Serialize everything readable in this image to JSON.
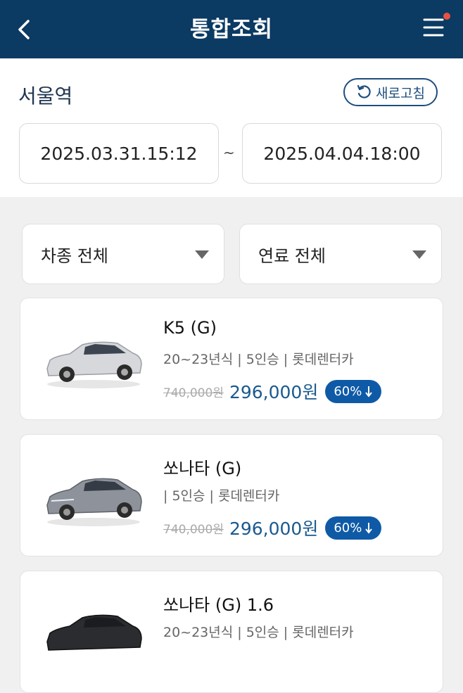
{
  "header": {
    "title": "통합조회"
  },
  "colors": {
    "header_bg": "#0b3a63",
    "accent": "#0f5aa6",
    "notification_dot": "#e8523f"
  },
  "search": {
    "station": "서울역",
    "refresh_label": "새로고침",
    "start": "2025.03.31.15:12",
    "separator": "~",
    "end": "2025.04.04.18:00"
  },
  "filters": {
    "car_type": "차종 전체",
    "fuel": "연료 전체"
  },
  "cars": [
    {
      "name": "K5 (G)",
      "spec": "20~23년식 | 5인승 | 롯데렌터카",
      "original_price": "740,000원",
      "price": "296,000원",
      "discount": "60%",
      "image_icon": "car-white-sedan-icon",
      "body_color": "#d6d8dc"
    },
    {
      "name": "쏘나타 (G)",
      "spec": "| 5인승 | 롯데렌터카",
      "original_price": "740,000원",
      "price": "296,000원",
      "discount": "60%",
      "image_icon": "car-gray-sedan-icon",
      "body_color": "#8d929b"
    },
    {
      "name": "쏘나타 (G) 1.6",
      "spec": "20~23년식 | 5인승 | 롯데렌터카",
      "image_icon": "car-black-sedan-icon",
      "body_color": "#2a2c30"
    }
  ]
}
